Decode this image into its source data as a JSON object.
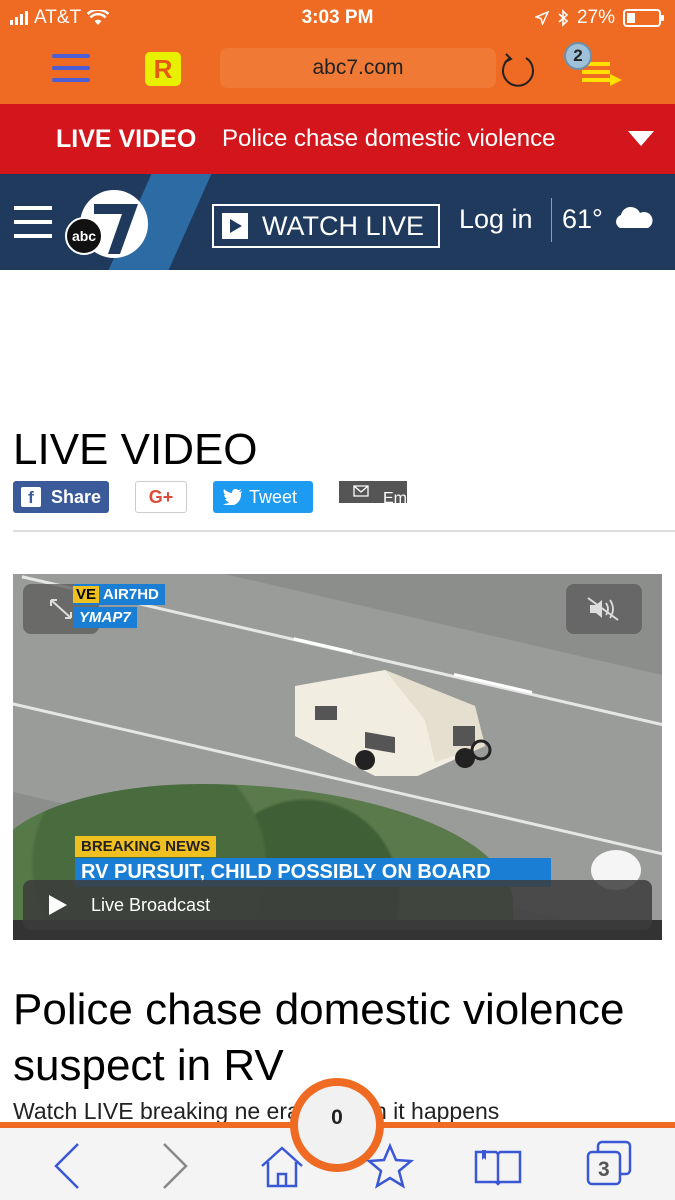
{
  "status_bar": {
    "carrier": "AT&T",
    "time": "3:03 PM",
    "battery": "27%",
    "battery_level": 0.27
  },
  "browser": {
    "url": "abc7.com",
    "logo_letter": "R",
    "tabs_badge": "2"
  },
  "live_banner": {
    "label": "LIVE VIDEO",
    "headline": "Police chase domestic violence"
  },
  "site_nav": {
    "watch_live": "WATCH LIVE",
    "login": "Log in",
    "temperature": "61°",
    "logo_text": "abc"
  },
  "page": {
    "title": "LIVE VIDEO",
    "share": {
      "facebook": "Share",
      "google": "G+",
      "twitter": "Tweet",
      "email": "Em"
    },
    "video": {
      "tag_live_prefix": "VE",
      "tag_live": "AIR7HD",
      "tag_map": "YMAP7",
      "breaking": "BREAKING NEWS",
      "lower_third": "RV PURSUIT, CHILD POSSIBLY ON BOARD",
      "live_label": "Live Broadcast"
    },
    "headline": "Police chase domestic violence suspect in RV",
    "teaser": "Watch LIVE breaking ne        erage when it happens"
  },
  "bottom_bar": {
    "counter": "0",
    "tabs_count": "3"
  },
  "colors": {
    "browser_orange": "#ef6a22",
    "live_red": "#d3161c",
    "abc_navy": "#1f3a5c",
    "icon_blue": "#3a57d6"
  }
}
